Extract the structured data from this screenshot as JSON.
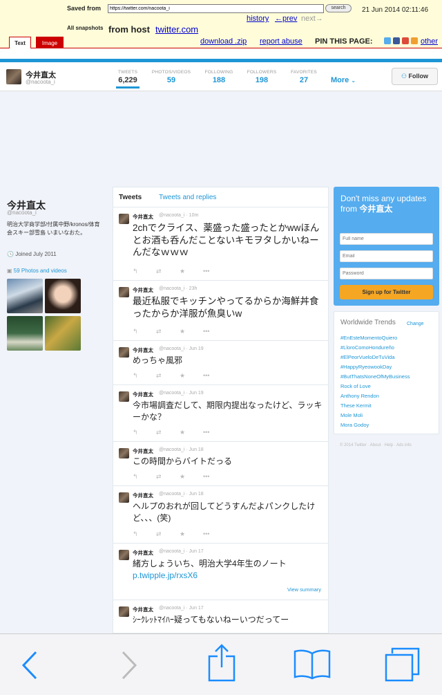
{
  "archive": {
    "saved_from_label": "Saved from",
    "url_value": "https://twitter.com/nacoota_i",
    "search_label": "search",
    "date": "21 Jun 2014 02:11:46",
    "history": "history",
    "prev": "←prev",
    "next": "next→",
    "all_snapshots_label": "All snapshots",
    "from_host_label": "from host",
    "host": "twitter.com",
    "download": "download .zip",
    "report": "report abuse",
    "pin": "PIN THIS PAGE:",
    "other": "other",
    "tab_text": "Text",
    "tab_image": "Image",
    "link_color": "#0000cc",
    "accent": "#cc0000"
  },
  "profile": {
    "name": "今井直太",
    "handle": "@nacoota_i",
    "stats": [
      {
        "label": "TWEETS",
        "value": "6,229"
      },
      {
        "label": "PHOTOS/VIDEOS",
        "value": "59"
      },
      {
        "label": "FOLLOWING",
        "value": "188"
      },
      {
        "label": "FOLLOWERS",
        "value": "198"
      },
      {
        "label": "FAVORITES",
        "value": "27"
      }
    ],
    "more": "More",
    "follow": "Follow",
    "bio": "明治大学商学部/付属中野/kronos/体育会スキー部雪島 いまいなおた。",
    "joined": "Joined July 2011",
    "photos": "59 Photos and videos",
    "brand_color": "#1e96d5"
  },
  "timeline": {
    "tab_tweets": "Tweets",
    "tab_replies": "Tweets and replies",
    "tweets": [
      {
        "name": "今井直太",
        "meta": "@nacoota_i · 10m",
        "text": "2chでクライス、薬盛った盛ったとかwwほんとお酒も呑んだことないキモヲタしかいねーんだなｗｗｗ",
        "link": "",
        "summary": ""
      },
      {
        "name": "今井直太",
        "meta": "@nacoota_i · 23h",
        "text": "最近私服でキッチンやってるからか海鮮丼食ったからか洋服が魚臭いw",
        "link": "",
        "summary": ""
      },
      {
        "name": "今井直太",
        "meta": "@nacoota_i · Jun 19",
        "text": "めっちゃ風邪",
        "link": "",
        "summary": ""
      },
      {
        "name": "今井直太",
        "meta": "@nacoota_i · Jun 19",
        "text": "今市場調査だして、期限内提出なったけど、ラッキーかな？",
        "link": "",
        "summary": ""
      },
      {
        "name": "今井直太",
        "meta": "@nacoota_i · Jun 18",
        "text": "この時間からバイトだっる",
        "link": "",
        "summary": ""
      },
      {
        "name": "今井直太",
        "meta": "@nacoota_i · Jun 18",
        "text": "ヘルプのおれが回してどうすんだよパンクしたけど、、、(笑)",
        "link": "",
        "summary": ""
      },
      {
        "name": "今井直太",
        "meta": "@nacoota_i · Jun 17",
        "text": "緒方しょういち、明治大学4年生のノート",
        "link": "p.twipple.jp/rxsX6",
        "summary": "View summary"
      },
      {
        "name": "今井直太",
        "meta": "@nacoota_i · Jun 17",
        "text": "ｼｰｸﾚｯﾄﾏｲﾊｰ疑ってもないねーいつだってー",
        "link": "",
        "summary": ""
      }
    ]
  },
  "signup": {
    "title_prefix": "Don't miss any updates from",
    "title_name": "今井直太",
    "fullname_placeholder": "Full name",
    "email_placeholder": "Email",
    "password_placeholder": "Password",
    "button": "Sign up for Twitter",
    "bg_color": "#55acee",
    "button_color": "#f5a623"
  },
  "trends": {
    "title": "Worldwide Trends",
    "change": "Change",
    "items": [
      "#EnEsteMomentoQuiero",
      "#LloroComoHondureño",
      "#ElPeorVueloDeTuVida",
      "#HappyRyeowookDay",
      "#ButThatsNoneOfMyBusiness",
      "Rock of Love",
      "Anthony Rendon",
      "These Kermit",
      "Mole Moli",
      "Mora Godoy"
    ]
  },
  "footer": "© 2014 Twitter · About · Help · Ads info",
  "safari": {
    "icons": [
      "back-icon",
      "forward-icon",
      "share-icon",
      "bookmarks-icon",
      "tabs-icon"
    ],
    "accent": "#1a8cff"
  }
}
